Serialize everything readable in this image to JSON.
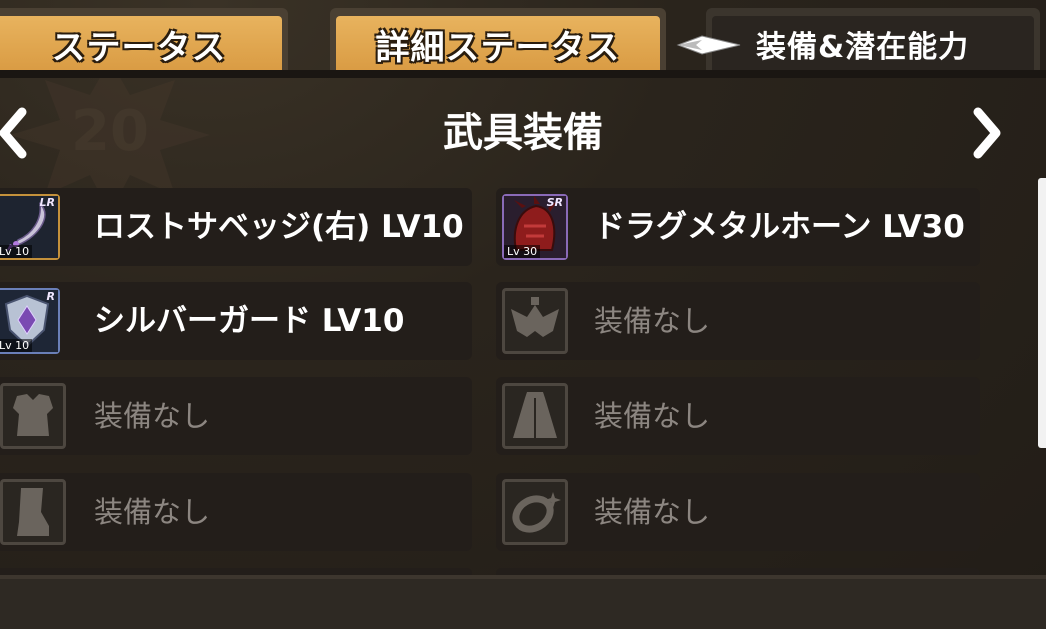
{
  "tabs": [
    {
      "label": "ステータス"
    },
    {
      "label": "詳細ステータス"
    },
    {
      "label": "装備&潜在能力"
    }
  ],
  "page_title": "武具装備",
  "slots": [
    {
      "name": "ロストサベッジ(右) LV10",
      "rarity": "LR",
      "level_tag": "Lv 10"
    },
    {
      "name": "ドラグメタルホーン LV30",
      "rarity": "SR",
      "level_tag": "Lv 30"
    },
    {
      "name": "シルバーガード LV10",
      "rarity": "R",
      "level_tag": "Lv 10"
    },
    {
      "name": "装備なし"
    },
    {
      "name": "装備なし"
    },
    {
      "name": "装備なし"
    },
    {
      "name": "装備なし"
    },
    {
      "name": "装備なし"
    }
  ],
  "colors": {
    "tab_gold": "#e0a850",
    "empty_text": "#8c8681",
    "slot_bg": "#231e1a"
  }
}
